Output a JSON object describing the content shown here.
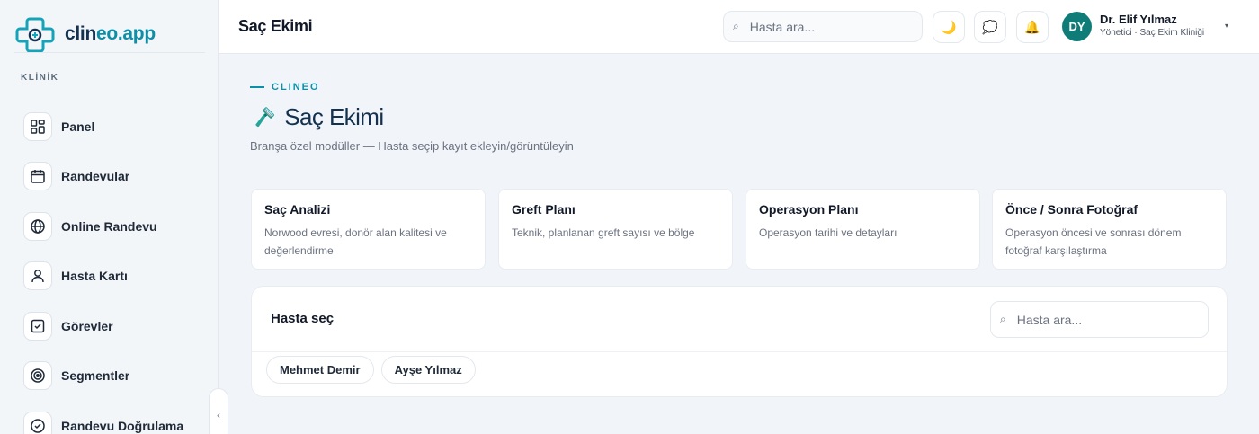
{
  "brand": {
    "name_part1": "clin",
    "name_part2": "eo.app"
  },
  "sidebar": {
    "section_label": "KLİNİK",
    "items": [
      {
        "label": "Panel",
        "icon": "dashboard-icon"
      },
      {
        "label": "Randevular",
        "icon": "calendar-icon"
      },
      {
        "label": "Online Randevu",
        "icon": "globe-icon"
      },
      {
        "label": "Hasta Kartı",
        "icon": "user-icon"
      },
      {
        "label": "Görevler",
        "icon": "checkbox-icon"
      },
      {
        "label": "Segmentler",
        "icon": "target-icon"
      },
      {
        "label": "Randevu Doğrulama",
        "icon": "check-circle-icon"
      }
    ],
    "collapse_icon": "‹"
  },
  "header": {
    "title": "Saç Ekimi",
    "search_placeholder": "Hasta ara...",
    "search_icon": "⌕",
    "theme_icon": "🌙",
    "chat_icon": "💭",
    "bell_icon": "🔔",
    "user": {
      "initials": "DY",
      "name": "Dr. Elif Yılmaz",
      "role": "Yönetici · Saç Ekim Kliniği",
      "caret": "▾"
    }
  },
  "main": {
    "eyebrow": "CLINEO",
    "title_icon": "🪒",
    "title": "Saç Ekimi",
    "subtitle": "Branşa özel modüller — Hasta seçip kayıt ekleyin/görüntüleyin",
    "cards": [
      {
        "title": "Saç Analizi",
        "desc": "Norwood evresi, donör alan kalitesi ve değerlendirme"
      },
      {
        "title": "Greft Planı",
        "desc": "Teknik, planlanan greft sayısı ve bölge"
      },
      {
        "title": "Operasyon Planı",
        "desc": "Operasyon tarihi ve detayları"
      },
      {
        "title": "Önce / Sonra Fotoğraf",
        "desc": "Operasyon öncesi ve sonrası dönem fotoğraf karşılaştırma"
      }
    ],
    "patient_panel": {
      "title": "Hasta seç",
      "search_placeholder": "Hasta ara...",
      "patients": [
        "Mehmet Demir",
        "Ayşe Yılmaz"
      ]
    }
  },
  "colors": {
    "accent": "#0e8fa8",
    "navy": "#14324f",
    "avatar_bg": "#0f7c78"
  }
}
